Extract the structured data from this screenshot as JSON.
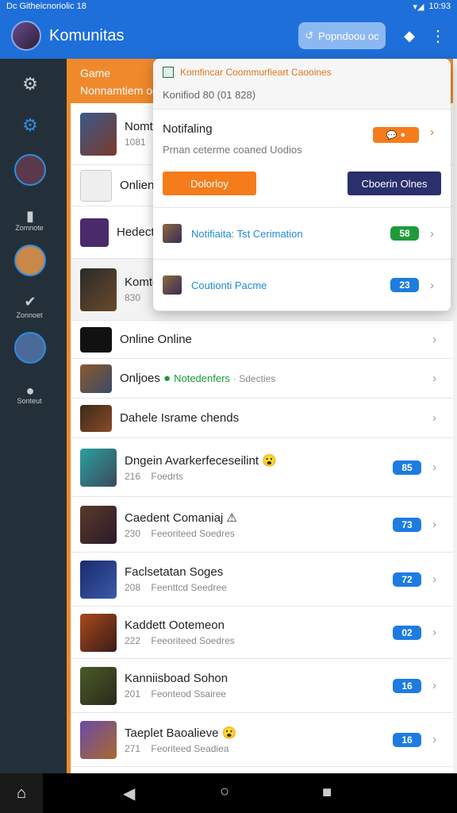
{
  "status": {
    "left": "Dc Githeicnoriolic 18",
    "time": "10:93"
  },
  "appbar": {
    "title": "Komunitas",
    "button": "Popndoou oc",
    "share_icon": "share-icon",
    "more_icon": "more-vertical-icon"
  },
  "rail": {
    "labels": [
      "Zomnote",
      "Zonnoet",
      "Sonteut"
    ]
  },
  "game_header": {
    "line1": "Game",
    "line2": "Nonnamtiem oo"
  },
  "popup": {
    "header_title": "Komfincar Coommurfieart Caooines",
    "header_sub": "Konifiod 80 (01 828)",
    "notif_title": "Notifaling",
    "notif_sub": "Prnan ceterme coaned Uodios",
    "btn_left": "Dolorloy",
    "btn_right": "Cboerin Olnes",
    "rows": [
      {
        "label": "Notifiaita: Tst Cerimation",
        "badge": "58",
        "color": "#1f9a3a"
      },
      {
        "label": "Coutionti Pacme",
        "badge": "23",
        "color": "#1e7ce0"
      }
    ]
  },
  "list": [
    {
      "title": "Nomt",
      "sub": "1081"
    },
    {
      "title": "Onlien"
    },
    {
      "title": "Hedect"
    },
    {
      "title": "Komter",
      "sub": "830"
    },
    {
      "title": "Online Online"
    },
    {
      "title": "Onljoes",
      "status": "Notedenfers",
      "status2": "· Sdecties"
    },
    {
      "title": "Dahele Israme chends"
    },
    {
      "title": "Dngein Avarkerfeceseilint 😮",
      "num": "216",
      "sub": "Foedrts",
      "badge": "85"
    },
    {
      "title": "Caedent Comaniaj ⚠",
      "num": "230",
      "sub": "Feeoriteed Soedres",
      "badge": "73"
    },
    {
      "title": "Faclsetatan Soges",
      "num": "208",
      "sub": "Feenttcd Seedree",
      "badge": "72"
    },
    {
      "title": "Kaddett Ootemeon",
      "num": "222",
      "sub": "Feeoriteed Soedres",
      "badge": "02"
    },
    {
      "title": "Kanniisboad Sohon",
      "num": "201",
      "sub": "Feonteod Ssairee",
      "badge": "16"
    },
    {
      "title": "Taeplet Baoalieve 😮",
      "num": "271",
      "sub": "Feoriteed Seadiea",
      "badge": "16"
    }
  ],
  "colors": {
    "primary": "#1e6fd9",
    "orange": "#f0892c",
    "badge_blue": "#1e7ce0",
    "green": "#1f9a3a"
  }
}
